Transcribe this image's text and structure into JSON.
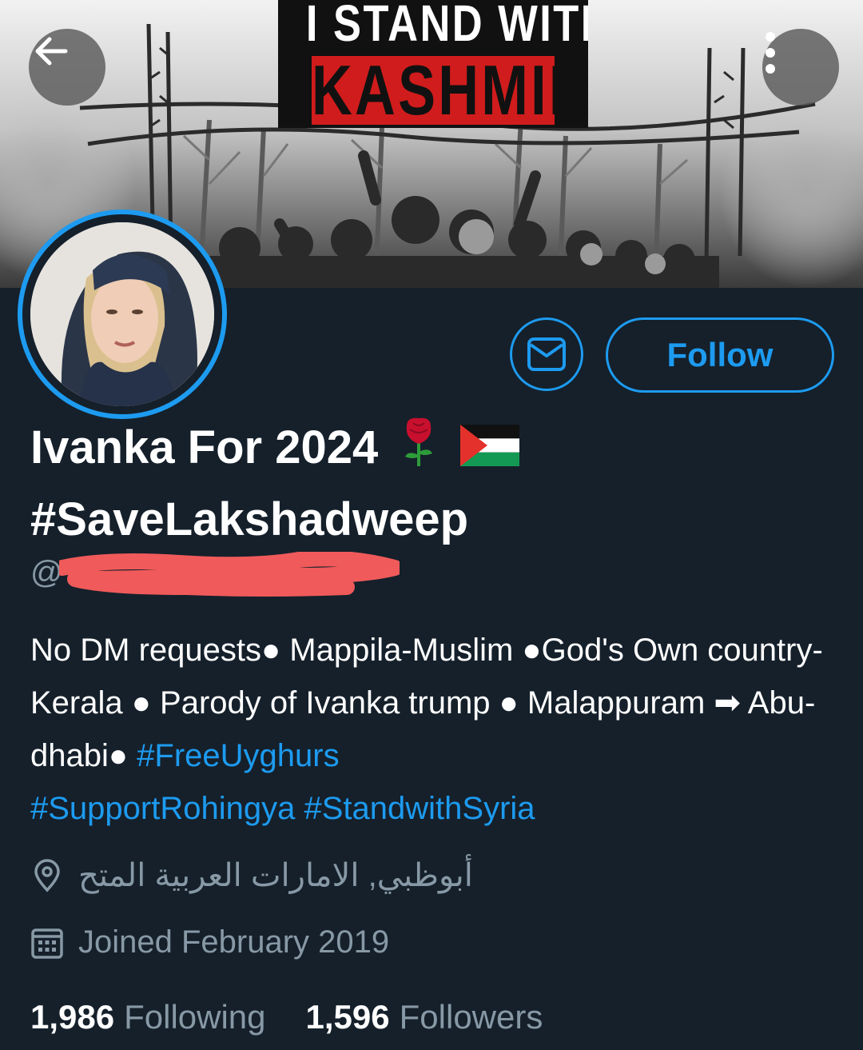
{
  "banner": {
    "line1": "I STAND WITH",
    "line2": "KASHMIR"
  },
  "header": {
    "back_icon": "arrow-left-icon",
    "more_icon": "more-vertical-icon"
  },
  "profile": {
    "display_name_line1": "Ivanka For 2024",
    "display_name_line2": "#SaveLakshadweep",
    "name_emojis": [
      "rose-emoji",
      "palestine-flag-emoji"
    ],
    "handle_prefix": "@",
    "message_icon": "envelope-icon",
    "follow_label": "Follow"
  },
  "bio": {
    "text_parts": [
      {
        "text": "No DM requests● Mappila-Muslim ●God's Own country-Kerala ● Parody of Ivanka trump ● Malappuram ➡ Abu-dhabi● ",
        "type": "text"
      },
      {
        "text": "#FreeUyghurs",
        "type": "hashtag"
      },
      {
        "text": " ",
        "type": "text"
      },
      {
        "text": "#SupportRohingya",
        "type": "hashtag"
      },
      {
        "text": " ",
        "type": "text"
      },
      {
        "text": "#StandwithSyria",
        "type": "hashtag"
      }
    ]
  },
  "meta": {
    "location": "أبوظبي, الامارات العربية المتح",
    "location_icon": "location-pin-icon",
    "joined": "Joined February 2019",
    "joined_icon": "calendar-icon"
  },
  "stats": {
    "following_count": "1,986",
    "following_label": "Following",
    "followers_count": "1,596",
    "followers_label": "Followers"
  },
  "colors": {
    "background": "#15202b",
    "accent": "#1d9bf0",
    "secondary_text": "#8899a6",
    "primary_text": "#ffffff",
    "banner_red": "#d01c1c"
  }
}
